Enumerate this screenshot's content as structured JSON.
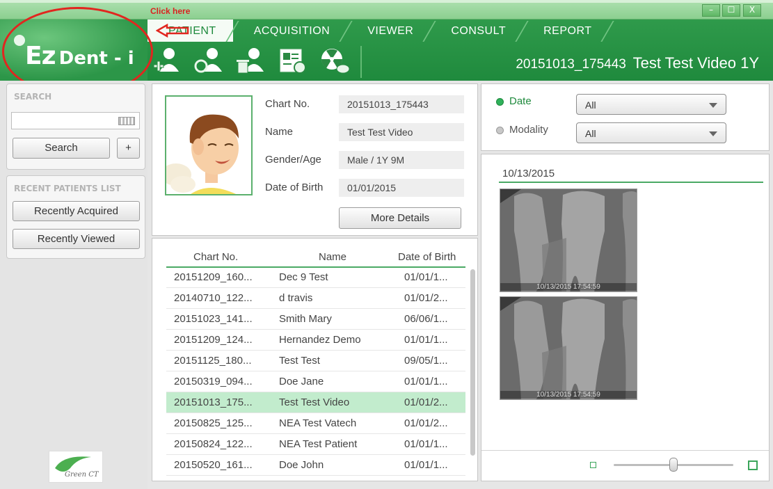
{
  "annotation": {
    "text": "Click here"
  },
  "window_controls": [
    "–",
    "☐",
    "X"
  ],
  "logo": {
    "part1": "Ez",
    "part2": "Dent - i"
  },
  "tabs": [
    {
      "label": "PATIENT",
      "active": true
    },
    {
      "label": "ACQUISITION",
      "active": false
    },
    {
      "label": "VIEWER",
      "active": false
    },
    {
      "label": "CONSULT",
      "active": false
    },
    {
      "label": "REPORT",
      "active": false
    }
  ],
  "toolbar": {
    "icons": [
      "add-patient-icon",
      "edit-patient-icon",
      "delete-patient-icon",
      "patient-card-icon",
      "radiation-dose-icon"
    ]
  },
  "banner": {
    "chart_no": "20151013_175443",
    "patient": "Test Test Video 1Y"
  },
  "search": {
    "title": "SEARCH",
    "button": "Search",
    "add_button": "+",
    "value": ""
  },
  "recent": {
    "title": "RECENT PATIENTS LIST",
    "acquired": "Recently Acquired",
    "viewed": "Recently Viewed"
  },
  "vendor_logo": {
    "text": "Green CT"
  },
  "patient_info": {
    "labels": {
      "chart_no": "Chart No.",
      "name": "Name",
      "gender_age": "Gender/Age",
      "dob": "Date of Birth"
    },
    "values": {
      "chart_no": "20151013_175443",
      "name": "Test Test Video",
      "gender_age": "Male / 1Y 9M",
      "dob": "01/01/2015"
    },
    "more_details": "More Details"
  },
  "patient_list": {
    "columns": [
      "Chart No.",
      "Name",
      "Date of Birth"
    ],
    "rows": [
      {
        "chart": "20151209_160...",
        "name": "Dec 9 Test",
        "dob": "01/01/1...",
        "selected": false
      },
      {
        "chart": "20140710_122...",
        "name": "d travis",
        "dob": "01/01/2...",
        "selected": false
      },
      {
        "chart": "20151023_141...",
        "name": "Smith Mary",
        "dob": "06/06/1...",
        "selected": false
      },
      {
        "chart": "20151209_124...",
        "name": "Hernandez Demo",
        "dob": "01/01/1...",
        "selected": false
      },
      {
        "chart": "20151125_180...",
        "name": "Test Test",
        "dob": "09/05/1...",
        "selected": false
      },
      {
        "chart": "20150319_094...",
        "name": "Doe Jane",
        "dob": "01/01/1...",
        "selected": false
      },
      {
        "chart": "20151013_175...",
        "name": "Test Test Video",
        "dob": "01/01/2...",
        "selected": true
      },
      {
        "chart": "20150825_125...",
        "name": "NEA Test Vatech",
        "dob": "01/01/2...",
        "selected": false
      },
      {
        "chart": "20150824_122...",
        "name": "NEA Test Patient",
        "dob": "01/01/1...",
        "selected": false
      },
      {
        "chart": "20150520_161...",
        "name": "Doe John",
        "dob": "01/01/1...",
        "selected": false
      }
    ]
  },
  "filters": {
    "date_label": "Date",
    "date_value": "All",
    "modality_label": "Modality",
    "modality_value": "All",
    "selected": "Date"
  },
  "images": {
    "date_header": "10/13/2015",
    "thumbnails": [
      {
        "timestamp": "10/13/2015 17:54:59"
      },
      {
        "timestamp": "10/13/2015 17:54:59"
      }
    ]
  },
  "zoom_slider": {
    "value_fraction": 0.5
  },
  "colors": {
    "brand_green": "#1f8a3d",
    "accent_green": "#4aa964",
    "selected_row": "#c2eccd",
    "annotation_red": "#e1261f"
  }
}
